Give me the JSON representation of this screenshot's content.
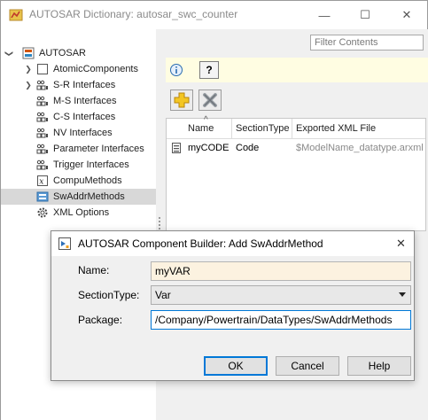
{
  "window": {
    "title": "AUTOSAR Dictionary: autosar_swc_counter",
    "minimize_glyph": "—",
    "maximize_glyph": "☐",
    "close_glyph": "✕"
  },
  "filter": {
    "placeholder": "Filter Contents"
  },
  "tree": {
    "root": {
      "label": "AUTOSAR",
      "expand_glyph": "❯"
    },
    "items": [
      {
        "label": "AtomicComponents",
        "icon": "component-icon",
        "expandable": true
      },
      {
        "label": "S-R Interfaces",
        "icon": "interface-icon",
        "expandable": true
      },
      {
        "label": "M-S Interfaces",
        "icon": "interface-icon",
        "expandable": false
      },
      {
        "label": "C-S Interfaces",
        "icon": "interface-icon",
        "expandable": false
      },
      {
        "label": "NV Interfaces",
        "icon": "interface-icon",
        "expandable": false
      },
      {
        "label": "Parameter Interfaces",
        "icon": "interface-icon",
        "expandable": false
      },
      {
        "label": "Trigger Interfaces",
        "icon": "interface-icon",
        "expandable": false
      },
      {
        "label": "CompuMethods",
        "icon": "function-icon",
        "expandable": false
      },
      {
        "label": "SwAddrMethods",
        "icon": "addr-method-icon",
        "expandable": false,
        "selected": true
      },
      {
        "label": "XML Options",
        "icon": "gear-icon",
        "expandable": false
      }
    ]
  },
  "toolbar": {
    "help_label": "?",
    "info_icon": "info-icon",
    "add_icon": "add-icon",
    "delete_icon": "delete-icon"
  },
  "table": {
    "sort_glyph": "^",
    "columns": [
      "Name",
      "SectionType",
      "Exported XML File"
    ],
    "rows": [
      {
        "name": "myCODE",
        "section_type": "Code",
        "xml_file": "$ModelName_datatype.arxml"
      }
    ]
  },
  "dialog": {
    "title": "AUTOSAR Component Builder: Add SwAddrMethod",
    "close_glyph": "✕",
    "name_label": "Name:",
    "name_value": "myVAR",
    "section_label": "SectionType:",
    "section_value": "Var",
    "package_label": "Package:",
    "package_value": "/Company/Powertrain/DataTypes/SwAddrMethods",
    "ok_label": "OK",
    "cancel_label": "Cancel",
    "help_label": "Help"
  },
  "colors": {
    "accent": "#0078d7",
    "selection": "#d8d8d8",
    "info_strip": "#fffde2",
    "name_field_bg": "#fcf2e0",
    "disabled_text": "#8a8a8a"
  }
}
